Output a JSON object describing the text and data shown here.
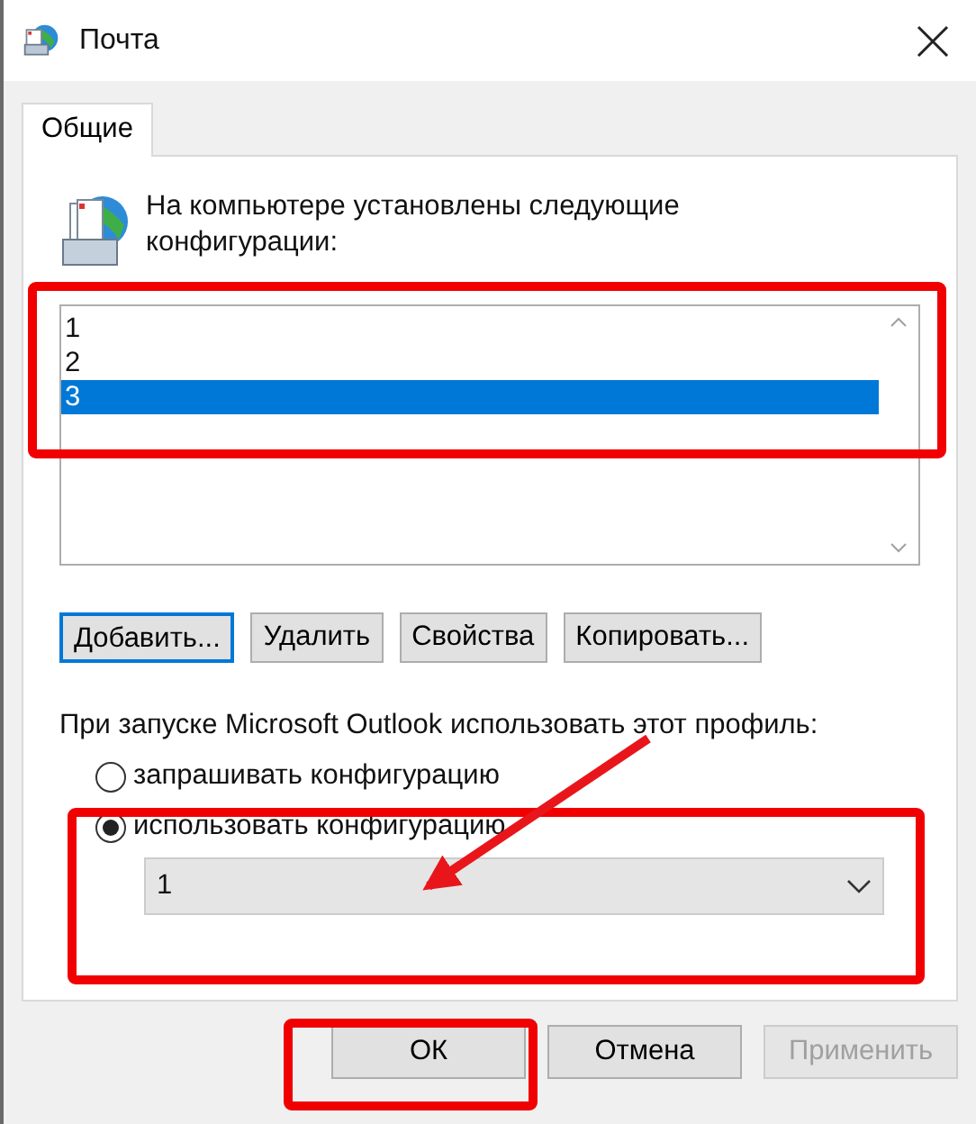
{
  "window": {
    "title": "Почта"
  },
  "tabs": [
    {
      "label": "Общие",
      "selected": true
    }
  ],
  "intro": "На компьютере установлены следующие конфигурации:",
  "profiles": [
    {
      "label": "1",
      "selected": false
    },
    {
      "label": "2",
      "selected": false
    },
    {
      "label": "3",
      "selected": true
    }
  ],
  "profile_buttons": [
    {
      "label": "Добавить...",
      "focused": true
    },
    {
      "label": "Удалить",
      "focused": false
    },
    {
      "label": "Свойства",
      "focused": false
    },
    {
      "label": "Копировать...",
      "focused": false
    }
  ],
  "startup_label": "При запуске Microsoft Outlook использовать этот профиль:",
  "startup_options": [
    {
      "label": "запрашивать конфигурацию",
      "selected": false
    },
    {
      "label": "использовать конфигурацию",
      "selected": true
    }
  ],
  "profile_dropdown": {
    "value": "1"
  },
  "buttons": [
    {
      "label": "ОК",
      "disabled": false
    },
    {
      "label": "Отмена",
      "disabled": false
    },
    {
      "label": "Применить",
      "disabled": true
    }
  ]
}
